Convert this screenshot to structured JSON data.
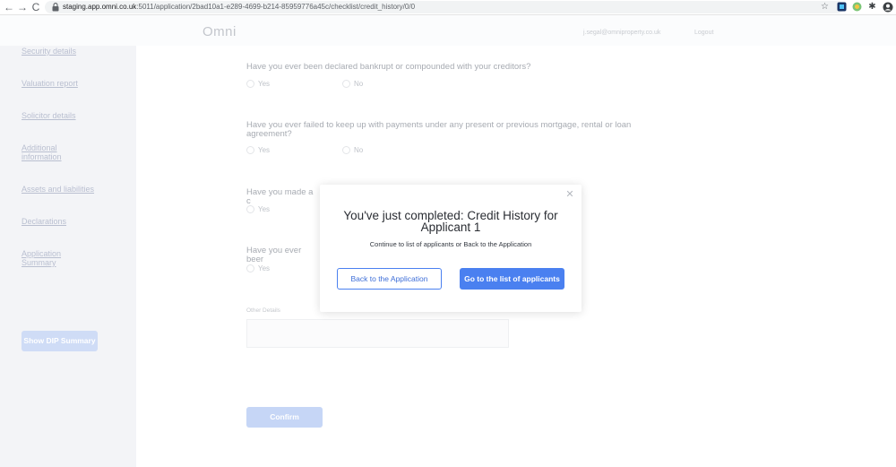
{
  "browser": {
    "url_host": "staging.app.omni.co.uk",
    "url_path": ":5011/application/2bad10a1-e289-4699-b214-85959776a45c/checklist/credit_history/0/0",
    "back_glyph": "←",
    "forward_glyph": "→",
    "reload_glyph": "C",
    "star_glyph": "☆",
    "puzzle_glyph": "✱",
    "profile_glyph": "●"
  },
  "header": {
    "logo": "Omni",
    "user_email": "j.segal@omniproperty.co.uk",
    "logout": "Logout"
  },
  "sidebar": {
    "items": [
      {
        "label": "Security details"
      },
      {
        "label": "Valuation report"
      },
      {
        "label": "Solicitor details"
      },
      {
        "label": "Additional information"
      },
      {
        "label": "Assets and liabilities"
      },
      {
        "label": "Declarations"
      },
      {
        "label": "Application Summary"
      }
    ],
    "dip_button": "Show DIP Summary"
  },
  "form": {
    "questions": [
      {
        "text": "Have you ever been declared bankrupt or compounded with your creditors?",
        "yes": "Yes",
        "no": "No"
      },
      {
        "text": "Have you ever failed to keep up with payments under any present or previous mortgage, rental or loan agreement?",
        "yes": "Yes",
        "no": "No"
      },
      {
        "text": "Have you made a c",
        "yes": "Yes"
      },
      {
        "text": "Have you ever beer",
        "yes": "Yes"
      }
    ],
    "other_details_label": "Other Details",
    "confirm_button": "Confirm"
  },
  "modal": {
    "close_glyph": "✕",
    "title": "You've just completed: Credit History for Applicant 1",
    "subtitle": "Continue to list of applicants or Back to the Application",
    "back_button": "Back to the Application",
    "list_button": "Go to the list of applicants"
  },
  "colors": {
    "accent": "#4a80f0",
    "sidebar_bg": "#f3f4f7",
    "muted_text": "#a7abb2"
  }
}
